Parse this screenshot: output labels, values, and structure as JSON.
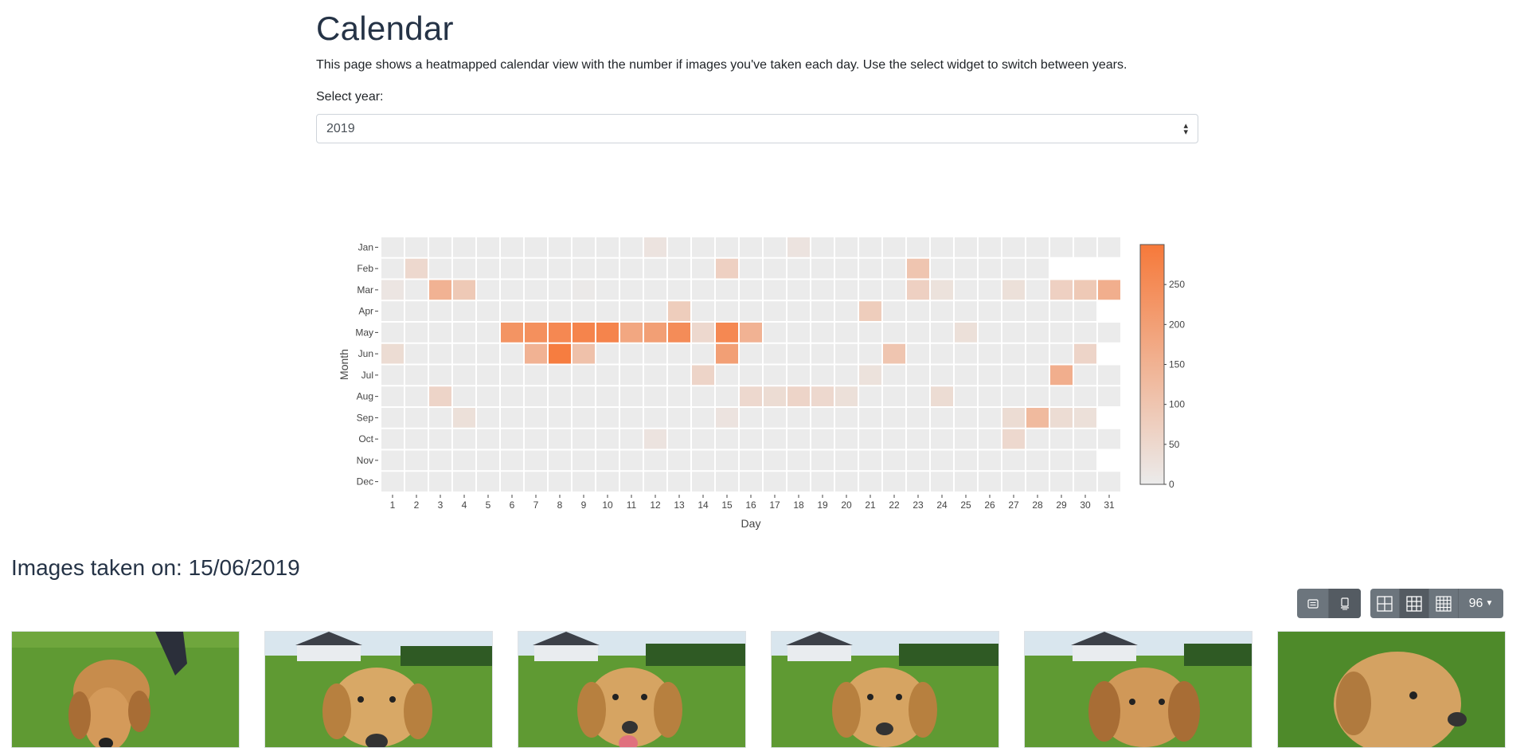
{
  "page": {
    "title": "Calendar",
    "intro": "This page shows a heatmapped calendar view with the number if images you've taken each day. Use the select widget to switch between years.",
    "select_label": "Select year:",
    "selected_year": "2019"
  },
  "chart_data": {
    "type": "heatmap",
    "xlabel": "Day",
    "ylabel": "Month",
    "x": [
      "1",
      "2",
      "3",
      "4",
      "5",
      "6",
      "7",
      "8",
      "9",
      "10",
      "11",
      "12",
      "13",
      "14",
      "15",
      "16",
      "17",
      "18",
      "19",
      "20",
      "21",
      "22",
      "23",
      "24",
      "25",
      "26",
      "27",
      "28",
      "29",
      "30",
      "31"
    ],
    "y": [
      "Jan",
      "Feb",
      "Mar",
      "Apr",
      "May",
      "Jun",
      "Jul",
      "Aug",
      "Sep",
      "Oct",
      "Nov",
      "Dec"
    ],
    "days_in_month": [
      31,
      28,
      31,
      30,
      31,
      30,
      31,
      31,
      30,
      31,
      30,
      31
    ],
    "values": [
      [
        0,
        0,
        0,
        0,
        0,
        0,
        0,
        0,
        0,
        0,
        0,
        20,
        0,
        0,
        0,
        0,
        0,
        20,
        0,
        0,
        0,
        0,
        0,
        0,
        0,
        0,
        0,
        0,
        0,
        0,
        0
      ],
      [
        0,
        50,
        0,
        0,
        0,
        0,
        0,
        0,
        0,
        0,
        0,
        0,
        0,
        0,
        70,
        0,
        0,
        0,
        0,
        0,
        0,
        0,
        100,
        0,
        0,
        0,
        0,
        0,
        0,
        0,
        0
      ],
      [
        15,
        0,
        150,
        90,
        0,
        0,
        0,
        0,
        5,
        0,
        0,
        0,
        0,
        0,
        0,
        0,
        0,
        0,
        0,
        0,
        0,
        0,
        70,
        25,
        0,
        0,
        30,
        0,
        70,
        90,
        160
      ],
      [
        0,
        0,
        0,
        0,
        0,
        0,
        0,
        0,
        0,
        0,
        0,
        0,
        80,
        0,
        0,
        0,
        0,
        0,
        0,
        0,
        80,
        0,
        0,
        0,
        0,
        0,
        0,
        0,
        0,
        0,
        0
      ],
      [
        0,
        0,
        0,
        0,
        0,
        230,
        240,
        260,
        270,
        270,
        180,
        200,
        250,
        50,
        260,
        150,
        0,
        0,
        0,
        0,
        0,
        0,
        0,
        0,
        30,
        0,
        0,
        0,
        0,
        0,
        0
      ],
      [
        40,
        0,
        0,
        0,
        0,
        0,
        150,
        290,
        110,
        0,
        0,
        0,
        0,
        0,
        200,
        0,
        0,
        0,
        0,
        0,
        0,
        100,
        0,
        0,
        0,
        0,
        0,
        0,
        0,
        60,
        0
      ],
      [
        0,
        0,
        0,
        0,
        0,
        0,
        0,
        0,
        0,
        0,
        0,
        0,
        0,
        60,
        0,
        0,
        0,
        0,
        0,
        0,
        25,
        0,
        0,
        0,
        0,
        0,
        0,
        0,
        160,
        0,
        0
      ],
      [
        0,
        0,
        60,
        0,
        0,
        0,
        0,
        0,
        0,
        0,
        0,
        0,
        0,
        0,
        0,
        50,
        40,
        60,
        50,
        30,
        0,
        0,
        0,
        40,
        0,
        0,
        0,
        0,
        0,
        0,
        0
      ],
      [
        0,
        0,
        0,
        30,
        0,
        0,
        0,
        0,
        0,
        0,
        0,
        0,
        0,
        0,
        20,
        0,
        0,
        0,
        0,
        0,
        0,
        0,
        0,
        0,
        0,
        0,
        40,
        130,
        40,
        30,
        0
      ],
      [
        0,
        0,
        0,
        0,
        0,
        0,
        0,
        0,
        0,
        0,
        0,
        20,
        0,
        0,
        0,
        0,
        0,
        0,
        0,
        0,
        0,
        0,
        0,
        0,
        0,
        0,
        50,
        0,
        0,
        0,
        0
      ],
      [
        0,
        0,
        0,
        0,
        0,
        0,
        0,
        0,
        0,
        0,
        0,
        0,
        0,
        0,
        0,
        0,
        0,
        0,
        0,
        0,
        0,
        0,
        0,
        0,
        0,
        0,
        0,
        0,
        0,
        0,
        0
      ],
      [
        0,
        0,
        0,
        0,
        0,
        0,
        0,
        0,
        0,
        0,
        0,
        0,
        0,
        0,
        0,
        0,
        0,
        0,
        0,
        0,
        0,
        0,
        0,
        0,
        0,
        0,
        0,
        0,
        0,
        0,
        0
      ]
    ],
    "colorscale": [
      "#ebebeb",
      "#f6793a"
    ],
    "zrange": [
      0,
      300
    ],
    "colorbar_ticks": [
      0,
      50,
      100,
      150,
      200,
      250
    ]
  },
  "gallery": {
    "heading": "Images taken on: 15/06/2019",
    "page_size": "96",
    "buttons": [
      "list-icon",
      "card-icon",
      "grid-large-icon",
      "grid-medium-icon",
      "grid-small-icon"
    ],
    "thumbnails": [
      "puppy-photo-1",
      "puppy-photo-2",
      "puppy-photo-3",
      "puppy-photo-4",
      "puppy-photo-5",
      "puppy-photo-6"
    ]
  }
}
